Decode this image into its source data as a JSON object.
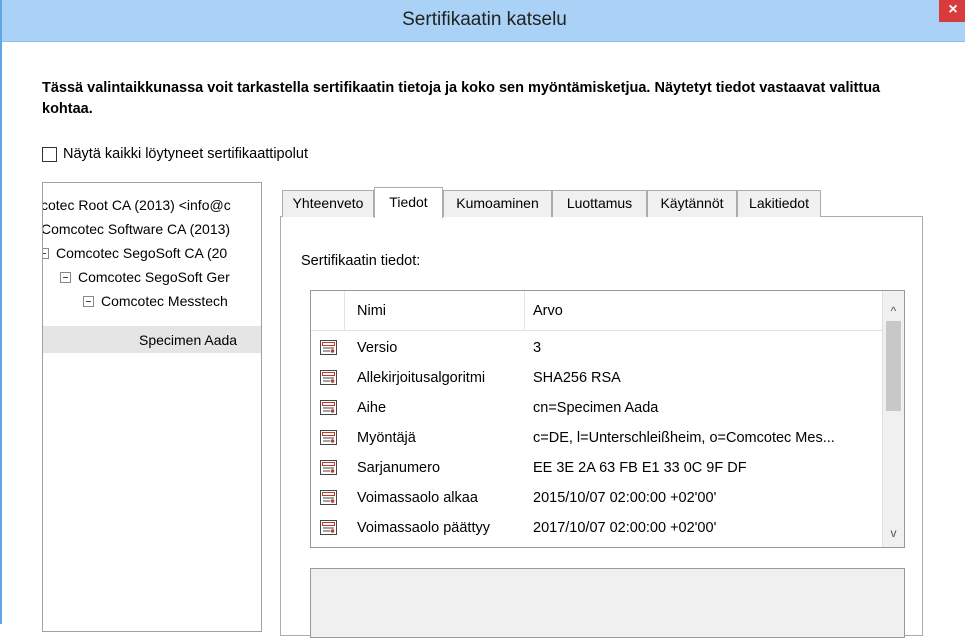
{
  "window": {
    "title": "Sertifikaatin katselu",
    "close_label": "×"
  },
  "description": "Tässä valintaikkunassa voit tarkastella sertifikaatin tietoja ja koko sen myöntämisketjua. Näytetyt tiedot vastaavat valittua kohtaa.",
  "show_all_paths": {
    "label": "Näytä kaikki löytyneet sertifikaattipolut",
    "checked": false
  },
  "tree": {
    "items": [
      {
        "label": "cotec Root CA (2013) <info@c",
        "expander": false
      },
      {
        "label": "Comcotec Software CA (2013)",
        "expander": false
      },
      {
        "label": "Comcotec SegoSoft CA (20",
        "expander": true
      },
      {
        "label": "Comcotec SegoSoft Ger",
        "expander": true
      },
      {
        "label": "Comcotec Messtech",
        "expander": true
      },
      {
        "label": "Specimen Aada",
        "expander": false,
        "selected": true
      }
    ]
  },
  "tabs": [
    {
      "label": "Yhteenveto"
    },
    {
      "label": "Tiedot",
      "active": true
    },
    {
      "label": "Kumoaminen"
    },
    {
      "label": "Luottamus"
    },
    {
      "label": "Käytännöt"
    },
    {
      "label": "Lakitiedot"
    }
  ],
  "details": {
    "heading": "Sertifikaatin tiedot:",
    "columns": {
      "name": "Nimi",
      "value": "Arvo"
    },
    "rows": [
      {
        "name": "Versio",
        "value": "3"
      },
      {
        "name": "Allekirjoitusalgoritmi",
        "value": "SHA256 RSA"
      },
      {
        "name": "Aihe",
        "value": "cn=Specimen Aada"
      },
      {
        "name": "Myöntäjä",
        "value": "c=DE, l=Unterschleißheim, o=Comcotec Mes..."
      },
      {
        "name": "Sarjanumero",
        "value": "EE 3E 2A 63 FB E1 33 0C 9F DF"
      },
      {
        "name": "Voimassaolo alkaa",
        "value": "2015/10/07 02:00:00 +02'00'"
      },
      {
        "name": "Voimassaolo päättyy",
        "value": "2017/10/07 02:00:00 +02'00'"
      }
    ]
  },
  "scrollbar": {
    "up": "^",
    "down": "v"
  },
  "colors": {
    "titlebar": "#a9d2f6",
    "close": "#d83b3b",
    "selection": "#e5e5e5"
  }
}
